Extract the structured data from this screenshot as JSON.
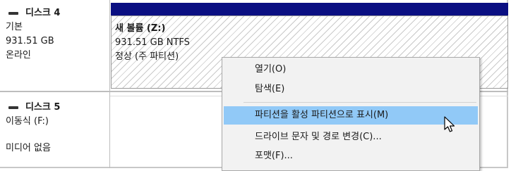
{
  "disk4": {
    "name": "디스크 4",
    "type": "기본",
    "size": "931.51 GB",
    "status": "온라인"
  },
  "volume": {
    "name": "새 볼륨 (Z:)",
    "size_fs": "931.51 GB NTFS",
    "status": "정상 (주 파티션)"
  },
  "disk5": {
    "name": "디스크 5",
    "type": "이동식 (F:)",
    "media": "미디어 없음"
  },
  "context_menu": {
    "items": [
      {
        "label": "열기(O)"
      },
      {
        "label": "탐색(E)"
      },
      {
        "label": "파티션을 활성 파티션으로 표시(M)",
        "highlighted": true
      },
      {
        "label": "드라이브 문자 및 경로 변경(C)..."
      },
      {
        "label": "포맷(F)..."
      }
    ]
  },
  "colors": {
    "partition_header": "#0a0f82",
    "menu_highlight": "#91c9f7"
  },
  "icons": {
    "disk": "dash-icon",
    "pointer": "mouse-cursor-icon"
  }
}
